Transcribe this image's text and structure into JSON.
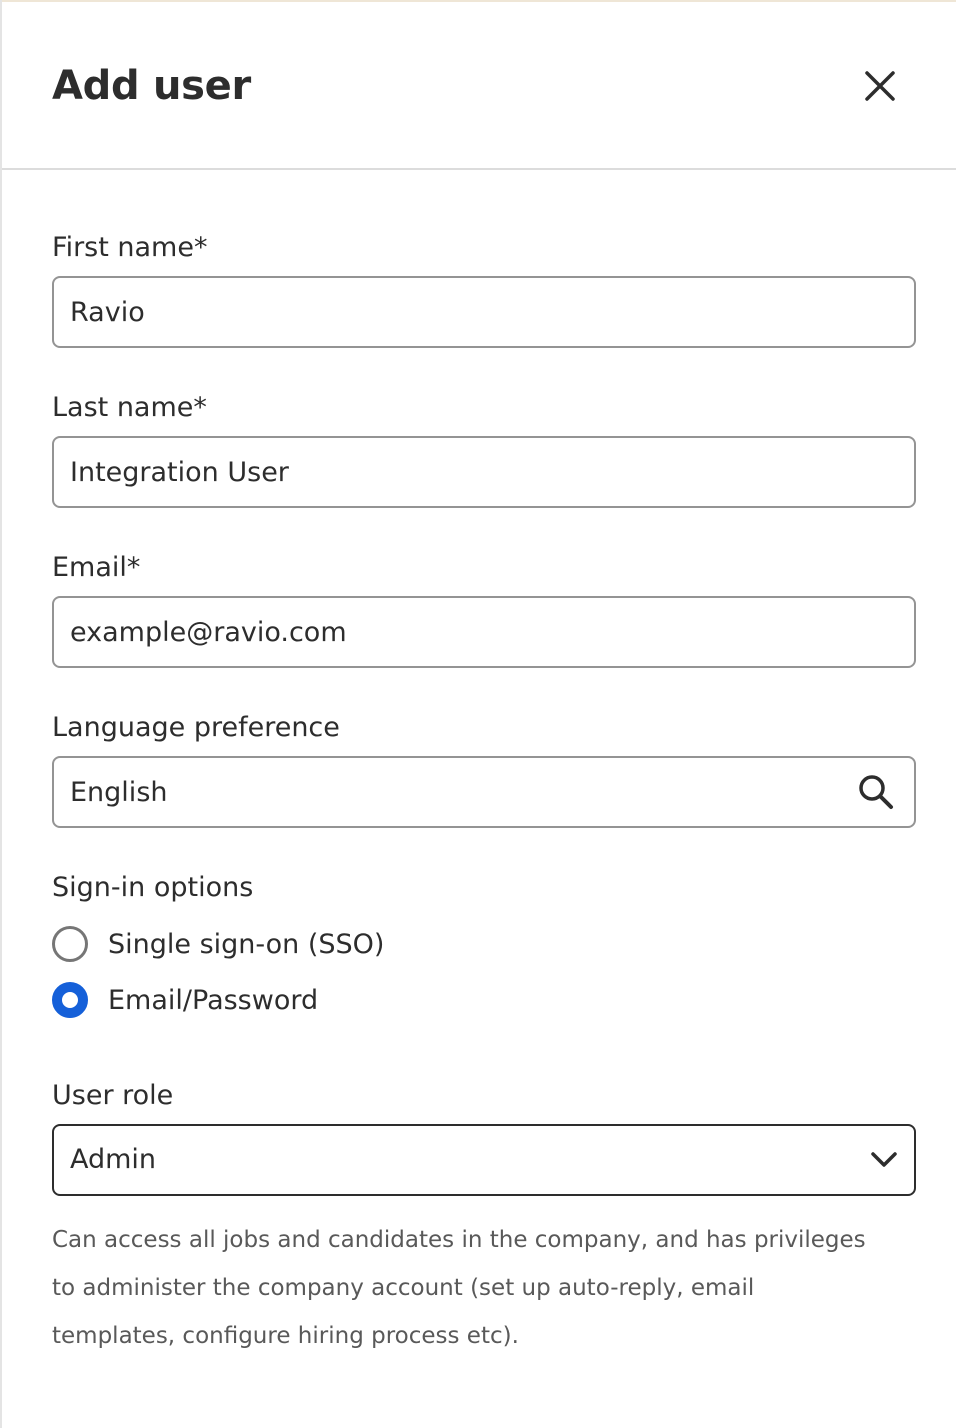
{
  "dialog": {
    "title": "Add user",
    "close_icon": "close-icon"
  },
  "form": {
    "first_name": {
      "label": "First name*",
      "value": "Ravio"
    },
    "last_name": {
      "label": "Last name*",
      "value": "Integration User"
    },
    "email": {
      "label": "Email*",
      "value": "example@ravio.com"
    },
    "language": {
      "label": "Language preference",
      "value": "English",
      "icon": "search-icon"
    },
    "sign_in": {
      "label": "Sign-in options",
      "options": [
        {
          "label": "Single sign-on (SSO)",
          "selected": false
        },
        {
          "label": "Email/Password",
          "selected": true
        }
      ]
    },
    "user_role": {
      "label": "User role",
      "selected": "Admin",
      "icon": "chevron-down-icon",
      "description": "Can access all jobs and candidates in the company, and has privileges to administer the company account (set up auto-reply, email templates, configure hiring process etc)."
    }
  },
  "colors": {
    "accent": "#1560d9",
    "text": "#2d2d2d",
    "muted_text": "#595959",
    "border": "#949494"
  }
}
